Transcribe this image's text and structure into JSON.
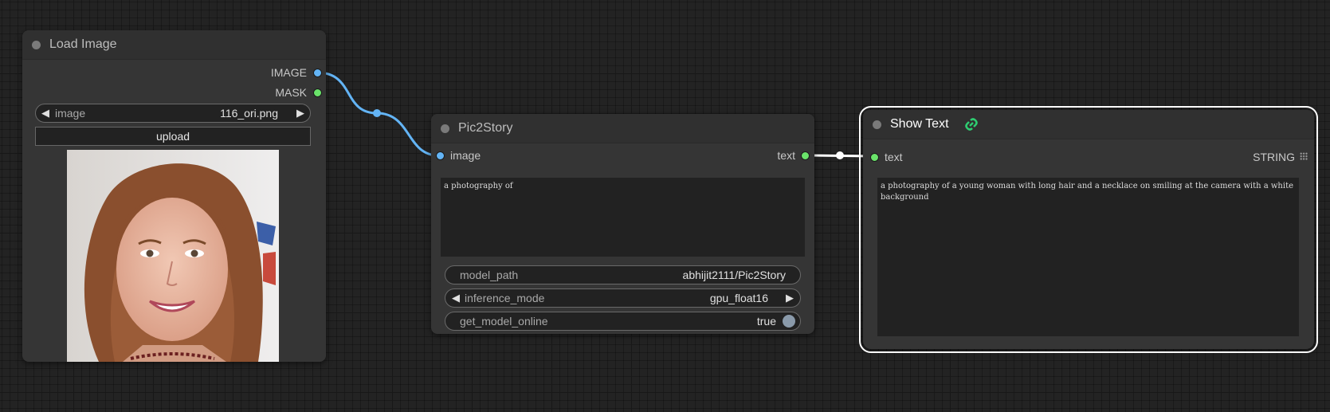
{
  "load_image": {
    "title": "Load Image",
    "outputs": {
      "image": "IMAGE",
      "mask": "MASK"
    },
    "image_widget": {
      "label": "image",
      "value": "116_ori.png"
    },
    "upload_label": "upload",
    "preview_icon": "portrait-photo"
  },
  "pic2story": {
    "title": "Pic2Story",
    "input_label": "image",
    "output_label": "text",
    "prompt_text": "a photography of",
    "widgets": {
      "model_path": {
        "label": "model_path",
        "value": "abhijit2111/Pic2Story"
      },
      "inference_mode": {
        "label": "inference_mode",
        "value": "gpu_float16"
      },
      "get_model_online": {
        "label": "get_model_online",
        "value": "true"
      }
    }
  },
  "show_text": {
    "title": "Show Text",
    "badge_icon": "link-chain-icon",
    "input_label": "text",
    "type_label": "STRING",
    "output_text": "a photography of a young woman with long hair and a necklace on smiling at the camera with a white background"
  },
  "colors": {
    "image_link": "#63b4f5",
    "text_link": "#ffffff",
    "string_slot": "#6ae36a",
    "badge": "#2ecc71"
  }
}
